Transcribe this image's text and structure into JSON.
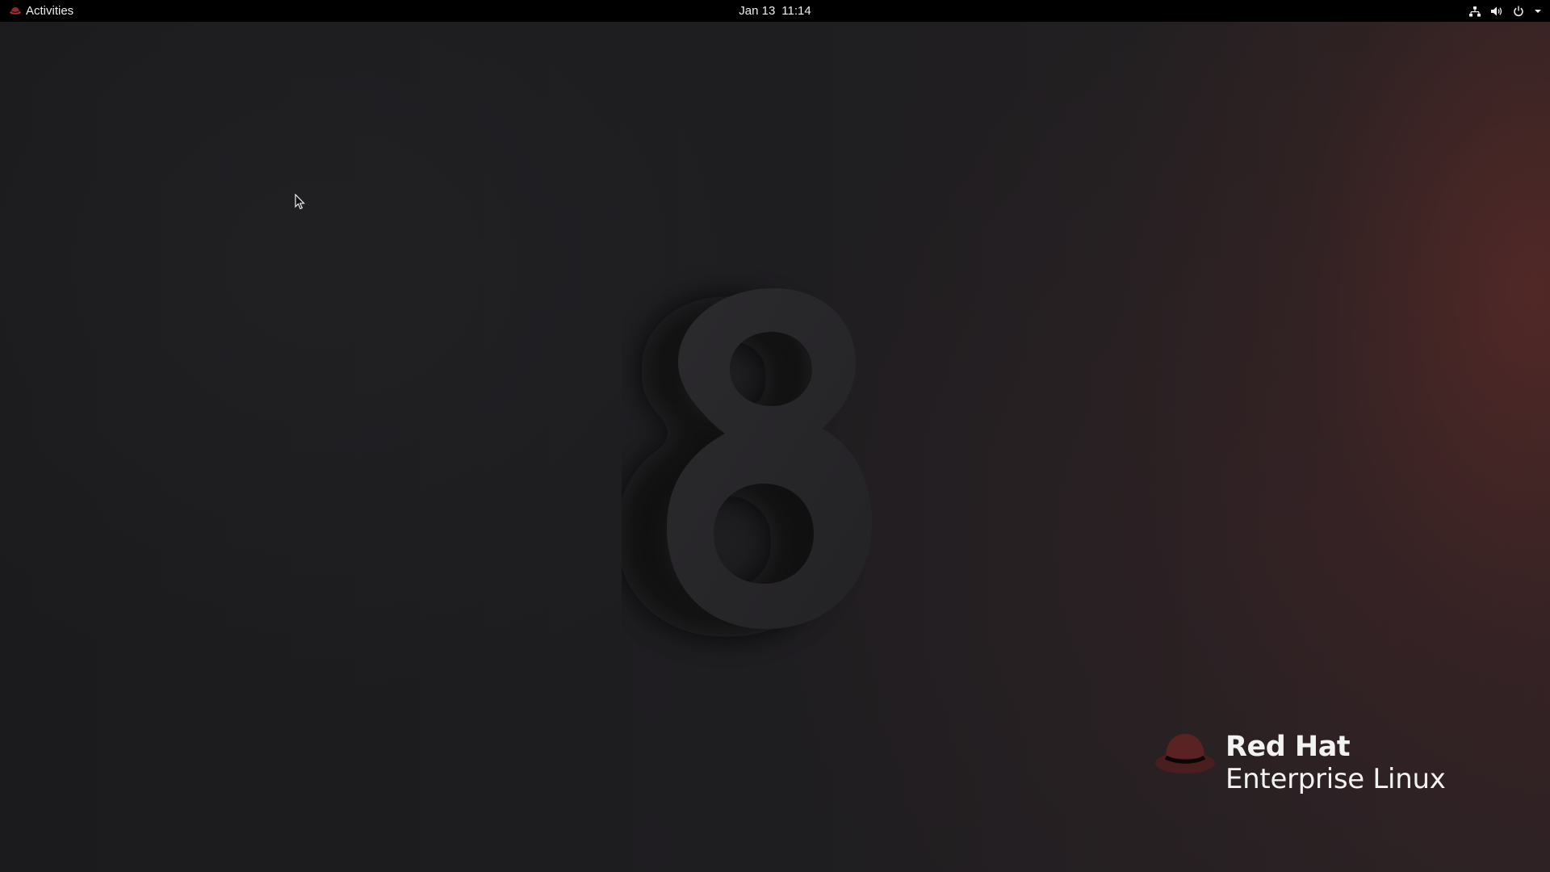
{
  "topbar": {
    "activities_label": "Activities",
    "activities_icon": "redhat-hat-icon",
    "date": "Jan 13",
    "time": "11:14",
    "tray_icons": [
      "network-wired-icon",
      "volume-icon",
      "power-icon",
      "chevron-down-icon"
    ]
  },
  "desktop": {
    "wallpaper_numeral": "8",
    "logo": {
      "line1": "Red Hat",
      "line2": "Enterprise Linux",
      "icon": "redhat-hat-icon"
    },
    "pointer": "mouse-pointer-icon"
  },
  "colors": {
    "topbar_bg": "#000000",
    "topbar_text": "#eeeeec",
    "wallpaper_dark": "#1d1c1f",
    "wallpaper_red_glow": "#6e2d28",
    "numeral": "#262528",
    "hat_red": "#5a2020"
  }
}
